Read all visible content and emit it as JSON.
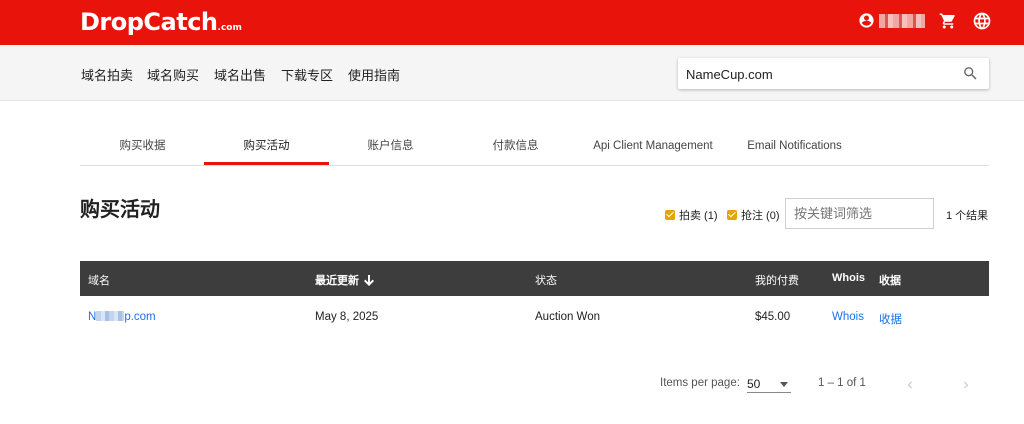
{
  "brand": {
    "logo_main": "DropCatch",
    "logo_suffix": ".com",
    "accent_color": "#e8140c"
  },
  "header": {
    "icons": [
      "account-icon",
      "cart-icon",
      "globe-icon"
    ]
  },
  "nav": {
    "items": [
      "域名拍卖",
      "域名购买",
      "域名出售",
      "下载专区",
      "使用指南"
    ]
  },
  "search": {
    "value": "NameCup.com"
  },
  "tabs": {
    "items": [
      "购买收据",
      "购买活动",
      "账户信息",
      "付款信息",
      "Api Client Management",
      "Email Notifications"
    ],
    "active": "购买活动"
  },
  "page": {
    "title": "购买活动",
    "filters": [
      {
        "label": "拍卖 (1)",
        "checked": true
      },
      {
        "label": "抢注 (0)",
        "checked": true
      }
    ],
    "filter_placeholder": "按关键词筛选",
    "result_count": "1 个结果"
  },
  "table": {
    "columns": [
      "域名",
      "最近更新",
      "状态",
      "我的付费",
      "Whois",
      "收据"
    ],
    "rows": [
      {
        "domain_start": "N",
        "domain_end": "p.com",
        "updated": "May 8, 2025",
        "status": "Auction Won",
        "paid": "$45.00",
        "whois": "Whois",
        "receipt": "收据"
      }
    ]
  },
  "paginator": {
    "items_per_page_label": "Items per page:",
    "page_size": "50",
    "range": "1 – 1 of 1"
  }
}
